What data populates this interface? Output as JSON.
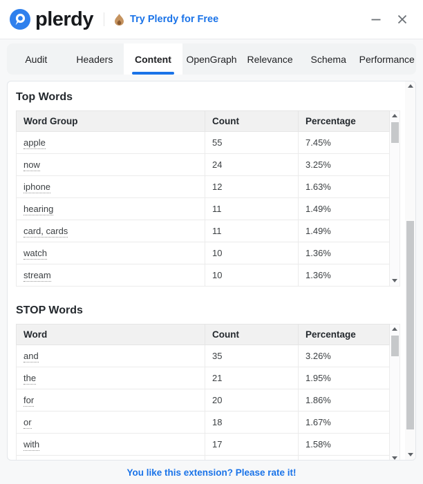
{
  "header": {
    "logo_text": "plerdy",
    "promo_label": "Try Plerdy for Free"
  },
  "tabs": [
    {
      "label": "Audit",
      "active": false
    },
    {
      "label": "Headers",
      "active": false
    },
    {
      "label": "Content",
      "active": true
    },
    {
      "label": "OpenGraph",
      "active": false
    },
    {
      "label": "Relevance",
      "active": false
    },
    {
      "label": "Schema",
      "active": false
    },
    {
      "label": "Performance",
      "active": false
    }
  ],
  "top_words": {
    "title": "Top Words",
    "columns": [
      "Word Group",
      "Count",
      "Percentage"
    ],
    "rows": [
      {
        "word": "apple",
        "count": "55",
        "percentage": "7.45%"
      },
      {
        "word": "now",
        "count": "24",
        "percentage": "3.25%"
      },
      {
        "word": "iphone",
        "count": "12",
        "percentage": "1.63%"
      },
      {
        "word": "hearing",
        "count": "11",
        "percentage": "1.49%"
      },
      {
        "word": "card, cards",
        "count": "11",
        "percentage": "1.49%"
      },
      {
        "word": "watch",
        "count": "10",
        "percentage": "1.36%"
      },
      {
        "word": "stream",
        "count": "10",
        "percentage": "1.36%"
      }
    ]
  },
  "stop_words": {
    "title": "STOP Words",
    "columns": [
      "Word",
      "Count",
      "Percentage"
    ],
    "rows": [
      {
        "word": "and",
        "count": "35",
        "percentage": "3.26%"
      },
      {
        "word": "the",
        "count": "21",
        "percentage": "1.95%"
      },
      {
        "word": "for",
        "count": "20",
        "percentage": "1.86%"
      },
      {
        "word": "or",
        "count": "18",
        "percentage": "1.67%"
      },
      {
        "word": "with",
        "count": "17",
        "percentage": "1.58%"
      },
      {
        "word": "",
        "count": "",
        "percentage": ""
      }
    ]
  },
  "footer": {
    "rate_label": "You like this extension? Please rate it!"
  },
  "colors": {
    "accent_blue": "#1a73e8",
    "logo_blue": "#2f80ed",
    "tabbar_bg": "#f1f3f4",
    "table_header_bg": "#f1f1f1",
    "flame_tan": "#c5935f"
  }
}
